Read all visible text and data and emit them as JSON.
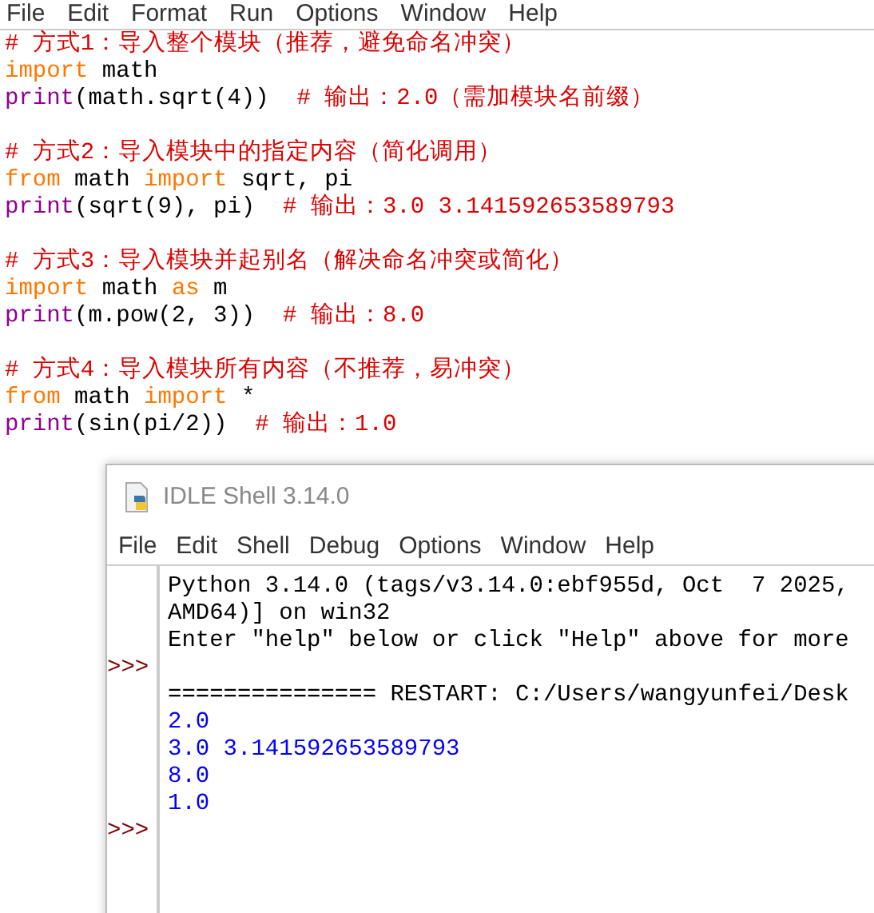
{
  "editor": {
    "menu": [
      "File",
      "Edit",
      "Format",
      "Run",
      "Options",
      "Window",
      "Help"
    ],
    "lines": [
      {
        "kind": "code",
        "tokens": [
          {
            "kind": "comment",
            "text": "# 方式1：导入整个模块（推荐，避免命名冲突）"
          }
        ]
      },
      {
        "kind": "code",
        "tokens": [
          {
            "kind": "keyword",
            "text": "import"
          },
          {
            "kind": "plain",
            "text": " math"
          }
        ]
      },
      {
        "kind": "code",
        "tokens": [
          {
            "kind": "builtin",
            "text": "print"
          },
          {
            "kind": "plain",
            "text": "(math.sqrt(4))  "
          },
          {
            "kind": "comment",
            "text": "# 输出：2.0（需加模块名前缀）"
          }
        ]
      },
      {
        "kind": "blank"
      },
      {
        "kind": "code",
        "tokens": [
          {
            "kind": "comment",
            "text": "# 方式2：导入模块中的指定内容（简化调用）"
          }
        ]
      },
      {
        "kind": "code",
        "tokens": [
          {
            "kind": "keyword",
            "text": "from"
          },
          {
            "kind": "plain",
            "text": " math "
          },
          {
            "kind": "keyword",
            "text": "import"
          },
          {
            "kind": "plain",
            "text": " sqrt, pi"
          }
        ]
      },
      {
        "kind": "code",
        "tokens": [
          {
            "kind": "builtin",
            "text": "print"
          },
          {
            "kind": "plain",
            "text": "(sqrt(9), pi)  "
          },
          {
            "kind": "comment",
            "text": "# 输出：3.0 3.141592653589793"
          }
        ]
      },
      {
        "kind": "blank"
      },
      {
        "kind": "code",
        "tokens": [
          {
            "kind": "comment",
            "text": "# 方式3：导入模块并起别名（解决命名冲突或简化）"
          }
        ]
      },
      {
        "kind": "code",
        "tokens": [
          {
            "kind": "keyword",
            "text": "import"
          },
          {
            "kind": "plain",
            "text": " math "
          },
          {
            "kind": "keyword",
            "text": "as"
          },
          {
            "kind": "plain",
            "text": " m"
          }
        ]
      },
      {
        "kind": "code",
        "tokens": [
          {
            "kind": "builtin",
            "text": "print"
          },
          {
            "kind": "plain",
            "text": "(m.pow(2, 3))  "
          },
          {
            "kind": "comment",
            "text": "# 输出：8.0"
          }
        ]
      },
      {
        "kind": "blank"
      },
      {
        "kind": "code",
        "tokens": [
          {
            "kind": "comment",
            "text": "# 方式4：导入模块所有内容（不推荐，易冲突）"
          }
        ]
      },
      {
        "kind": "code",
        "tokens": [
          {
            "kind": "keyword",
            "text": "from"
          },
          {
            "kind": "plain",
            "text": " math "
          },
          {
            "kind": "keyword",
            "text": "import"
          },
          {
            "kind": "plain",
            "text": " *"
          }
        ]
      },
      {
        "kind": "code",
        "tokens": [
          {
            "kind": "builtin",
            "text": "print"
          },
          {
            "kind": "plain",
            "text": "(sin(pi/2))  "
          },
          {
            "kind": "comment",
            "text": "# 输出：1.0"
          }
        ]
      }
    ]
  },
  "shell": {
    "title": "IDLE Shell 3.14.0",
    "menu": [
      "File",
      "Edit",
      "Shell",
      "Debug",
      "Options",
      "Window",
      "Help"
    ],
    "prompt": ">>>",
    "lines": [
      {
        "kind": "info",
        "prompt": false,
        "text": "Python 3.14.0 (tags/v3.14.0:ebf955d, Oct  7 2025,"
      },
      {
        "kind": "info",
        "prompt": false,
        "text": "AMD64)] on win32"
      },
      {
        "kind": "info",
        "prompt": false,
        "text": "Enter \"help\" below or click \"Help\" above for more"
      },
      {
        "kind": "blank",
        "prompt": true
      },
      {
        "kind": "info",
        "prompt": false,
        "text": "=============== RESTART: C:/Users/wangyunfei/Desk"
      },
      {
        "kind": "output",
        "prompt": false,
        "text": "2.0"
      },
      {
        "kind": "output",
        "prompt": false,
        "text": "3.0 3.141592653589793"
      },
      {
        "kind": "output",
        "prompt": false,
        "text": "8.0"
      },
      {
        "kind": "output",
        "prompt": false,
        "text": "1.0"
      },
      {
        "kind": "blank",
        "prompt": true
      }
    ]
  }
}
